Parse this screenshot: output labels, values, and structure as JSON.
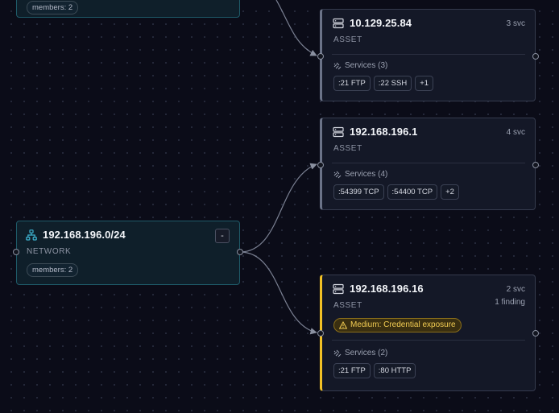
{
  "nodes": {
    "network_top": {
      "members_label": "members: 2"
    },
    "network": {
      "title": "192.168.196.0/24",
      "type": "NETWORK",
      "members_label": "members: 2",
      "collapse_label": "-",
      "icon": "network-icon"
    },
    "asset1": {
      "title": "10.129.25.84",
      "type": "ASSET",
      "svc_count": "3 svc",
      "services_label": "Services (3)",
      "chips": [
        ":21 FTP",
        ":22 SSH",
        "+1"
      ],
      "icon": "server-icon"
    },
    "asset2": {
      "title": "192.168.196.1",
      "type": "ASSET",
      "svc_count": "4 svc",
      "services_label": "Services (4)",
      "chips": [
        ":54399 TCP",
        ":54400 TCP",
        "+2"
      ],
      "icon": "server-icon"
    },
    "asset3": {
      "title": "192.168.196.16",
      "type": "ASSET",
      "svc_count": "2 svc",
      "findings": "1 finding",
      "badge": "Medium: Credential exposure",
      "services_label": "Services (2)",
      "chips": [
        ":21 FTP",
        ":80 HTTP"
      ],
      "icon": "server-icon",
      "accent": "#f2c125"
    }
  },
  "colors": {
    "background": "#0b0c18",
    "network_border": "#1e5a68",
    "network_icon": "#3fb6d4",
    "warning": "#f2c125"
  }
}
